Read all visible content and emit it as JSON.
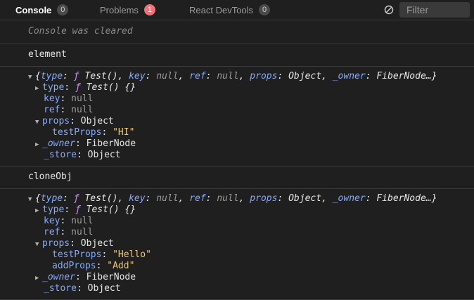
{
  "tabs": [
    {
      "label": "Console",
      "count": "0"
    },
    {
      "label": "Problems",
      "count": "1"
    },
    {
      "label": "React DevTools",
      "count": "0"
    }
  ],
  "filter": {
    "placeholder": "Filter"
  },
  "console": {
    "cleared": "Console was cleared",
    "log1_label": "element",
    "log2_label": "cloneObj",
    "obj": {
      "open": "{",
      "close": "}",
      "type_key": "type",
      "key_key": "key",
      "ref_key": "ref",
      "props_key": "props",
      "owner_key": "_owner",
      "store_key": "_store",
      "colon": ": ",
      "comma": ", ",
      "f": "ƒ",
      "test_sig": "Test()",
      "test_sig_body": "Test() {}",
      "null": "null",
      "object": "Object",
      "fibernode": "FiberNode",
      "fibernode_trunc": "FiberNode…"
    },
    "element_props": {
      "testProps_key": "testProps",
      "testProps_val": "\"HI\""
    },
    "clone_props": {
      "testProps_key": "testProps",
      "testProps_val": "\"Hello\"",
      "addProps_key": "addProps",
      "addProps_val": "\"Add\""
    }
  },
  "colors": {
    "accent_string": "#f7c56b",
    "key": "#82aaff",
    "error_badge": "#f07178"
  },
  "icons": {
    "clear": "clear-console-icon",
    "expanded": "triangle-down-icon",
    "collapsed": "triangle-right-icon"
  }
}
